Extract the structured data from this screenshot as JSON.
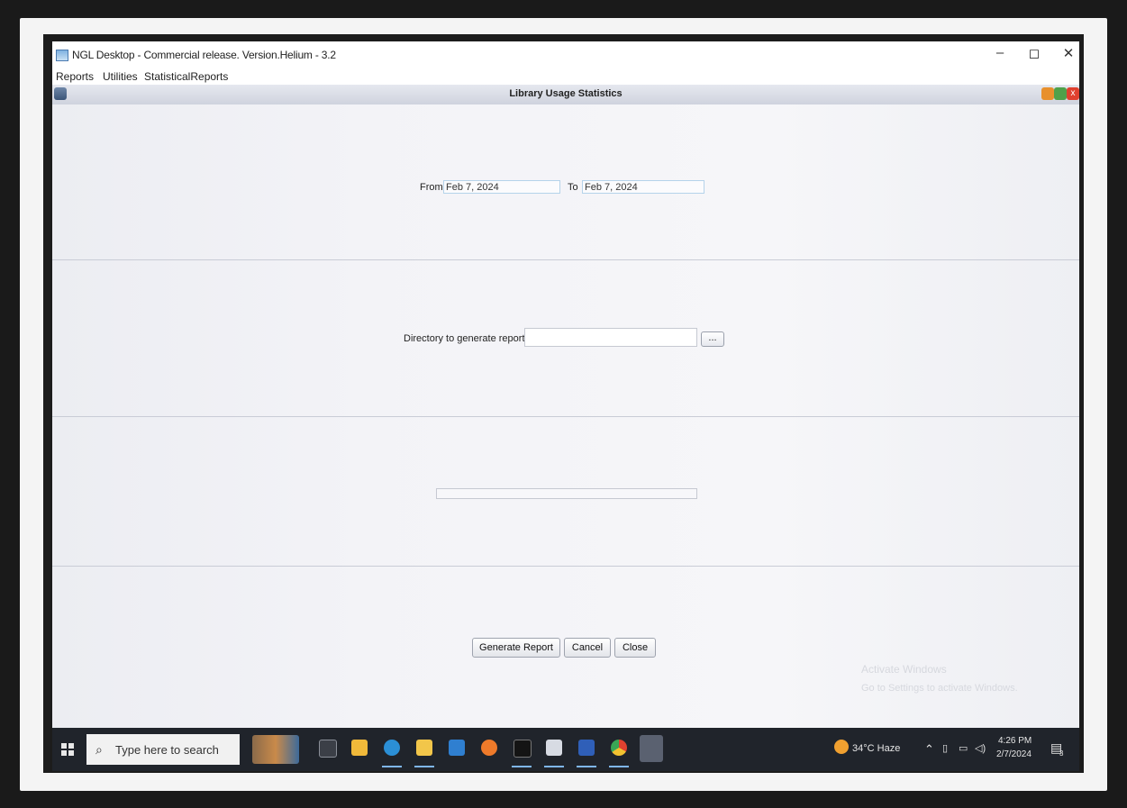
{
  "window": {
    "title": "NGL Desktop - Commercial release. Version.Helium - 3.2",
    "controls": {
      "minimize": "–",
      "maximize": "◻",
      "close": "✕"
    }
  },
  "menu": [
    "Reports",
    "Utilities",
    "StatisticalReports"
  ],
  "internal_frame": {
    "title": "Library Usage Statistics"
  },
  "date_range": {
    "from_label": "From",
    "from_value": "Feb 7, 2024",
    "to_label": "To",
    "to_value": "Feb 7, 2024"
  },
  "directory": {
    "label": "Directory to generate reports",
    "value": "",
    "browse_label": "..."
  },
  "progress": {
    "value": 0
  },
  "buttons": {
    "generate": "Generate Report",
    "cancel": "Cancel",
    "close": "Close"
  },
  "watermark": {
    "line1": "Activate Windows",
    "line2": "Go to Settings to activate Windows."
  },
  "taskbar": {
    "search_placeholder": "Type here to search",
    "weather": "34°C  Haze",
    "time": "4:26 PM",
    "date": "2/7/2024",
    "notification_count": "3"
  },
  "colors": {
    "frame_close": "#e0412f",
    "frame_maximize": "#4fa14a",
    "frame_iconify": "#e8902d",
    "taskbar": "#20242b"
  }
}
